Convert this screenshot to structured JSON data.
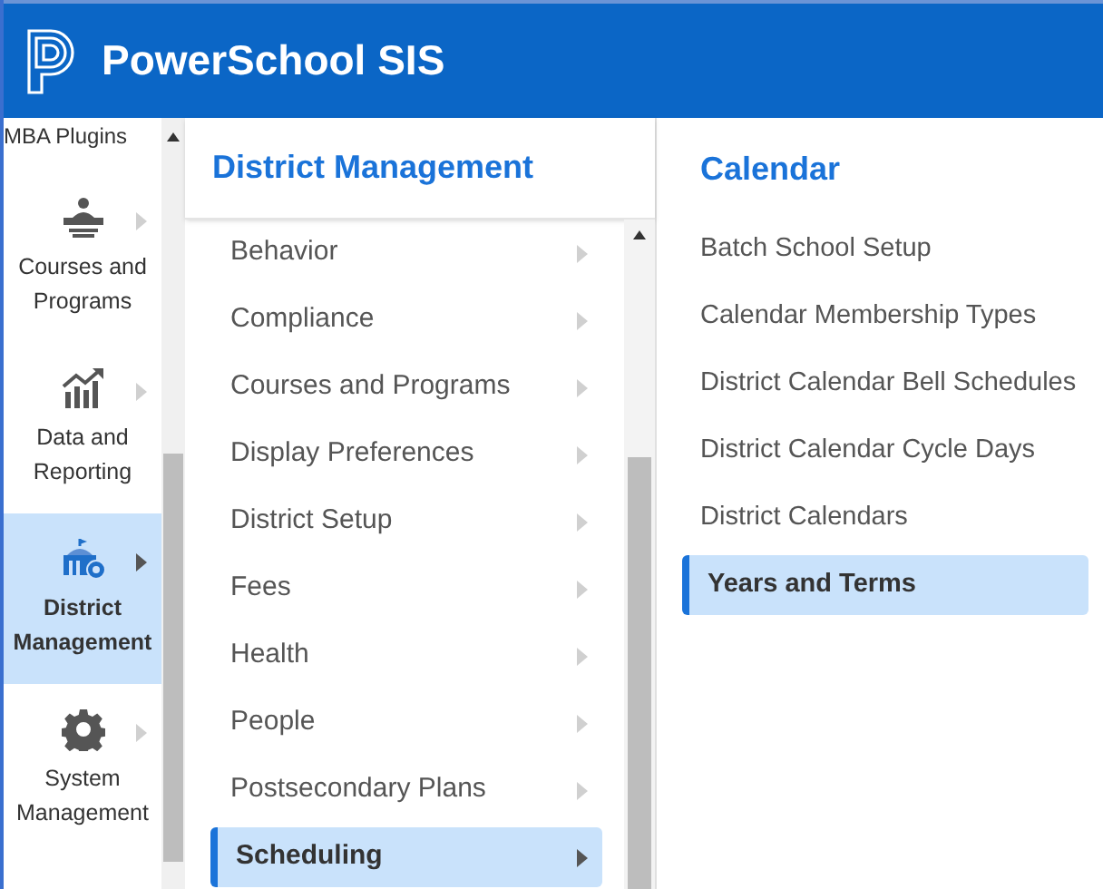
{
  "header": {
    "title": "PowerSchool SIS"
  },
  "rail": {
    "items": [
      {
        "label": "MBA Plugins",
        "selected": false
      },
      {
        "label": "Courses and Programs",
        "selected": false
      },
      {
        "label": "Data and Reporting",
        "selected": false
      },
      {
        "label": "District Management",
        "selected": true
      },
      {
        "label": "System Management",
        "selected": false
      }
    ]
  },
  "menu": {
    "title": "District Management",
    "items": [
      {
        "label": "Behavior",
        "selected": false
      },
      {
        "label": "Compliance",
        "selected": false
      },
      {
        "label": "Courses and Programs",
        "selected": false
      },
      {
        "label": "Display Preferences",
        "selected": false
      },
      {
        "label": "District Setup",
        "selected": false
      },
      {
        "label": "Fees",
        "selected": false
      },
      {
        "label": "Health",
        "selected": false
      },
      {
        "label": "People",
        "selected": false
      },
      {
        "label": "Postsecondary Plans",
        "selected": false
      },
      {
        "label": "Scheduling",
        "selected": true
      }
    ]
  },
  "submenu": {
    "title": "Calendar",
    "items": [
      {
        "label": "Batch School Setup",
        "selected": false
      },
      {
        "label": "Calendar Membership Types",
        "selected": false
      },
      {
        "label": "District Calendar Bell Schedules",
        "selected": false
      },
      {
        "label": "District Calendar Cycle Days",
        "selected": false
      },
      {
        "label": "District Calendars",
        "selected": false
      },
      {
        "label": "Years and Terms",
        "selected": true
      }
    ]
  }
}
